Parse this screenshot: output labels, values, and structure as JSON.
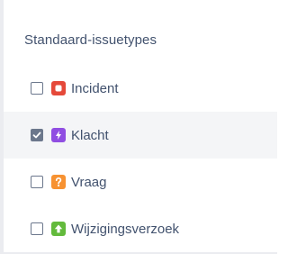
{
  "section": {
    "heading": "Standaard-issuetypes",
    "items": [
      {
        "label": "Incident",
        "checked": false,
        "icon": "incident-icon",
        "color": "#e5493a"
      },
      {
        "label": "Klacht",
        "checked": true,
        "icon": "complaint-icon",
        "color": "#904ee2"
      },
      {
        "label": "Vraag",
        "checked": false,
        "icon": "question-icon",
        "color": "#f79232"
      },
      {
        "label": "Wijzigingsverzoek",
        "checked": false,
        "icon": "change-request-icon",
        "color": "#63ba3c"
      }
    ]
  },
  "colors": {
    "text": "#42526e",
    "selected_row": "#f4f5f7",
    "checkbox_border": "#6b778c"
  }
}
